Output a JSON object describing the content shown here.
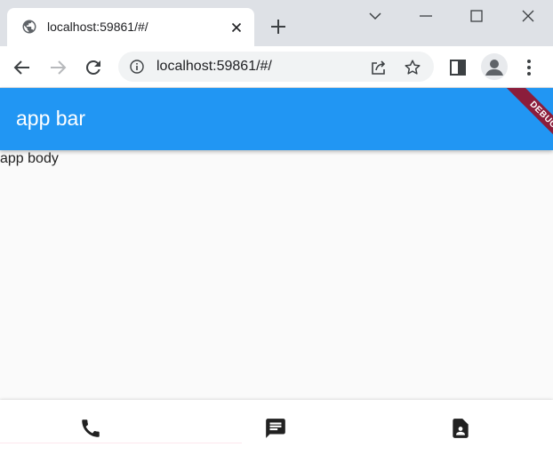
{
  "browser": {
    "tab": {
      "title": "localhost:59861/#/",
      "favicon": "globe-icon"
    },
    "address_bar": {
      "url": "localhost:59861/#/"
    },
    "colors": {
      "tabstrip": "#dee1e6",
      "toolbar": "#ffffff",
      "omnibox": "#f1f3f4"
    }
  },
  "app": {
    "app_bar": {
      "title": "app bar",
      "color": "#2196f3"
    },
    "debug_banner": {
      "label": "DEBUG",
      "color": "#8b1d3b"
    },
    "body": {
      "text": "app body"
    },
    "bottom_nav": {
      "items": [
        {
          "icon": "phone-icon"
        },
        {
          "icon": "message-icon"
        },
        {
          "icon": "contact-document-icon"
        }
      ]
    }
  }
}
